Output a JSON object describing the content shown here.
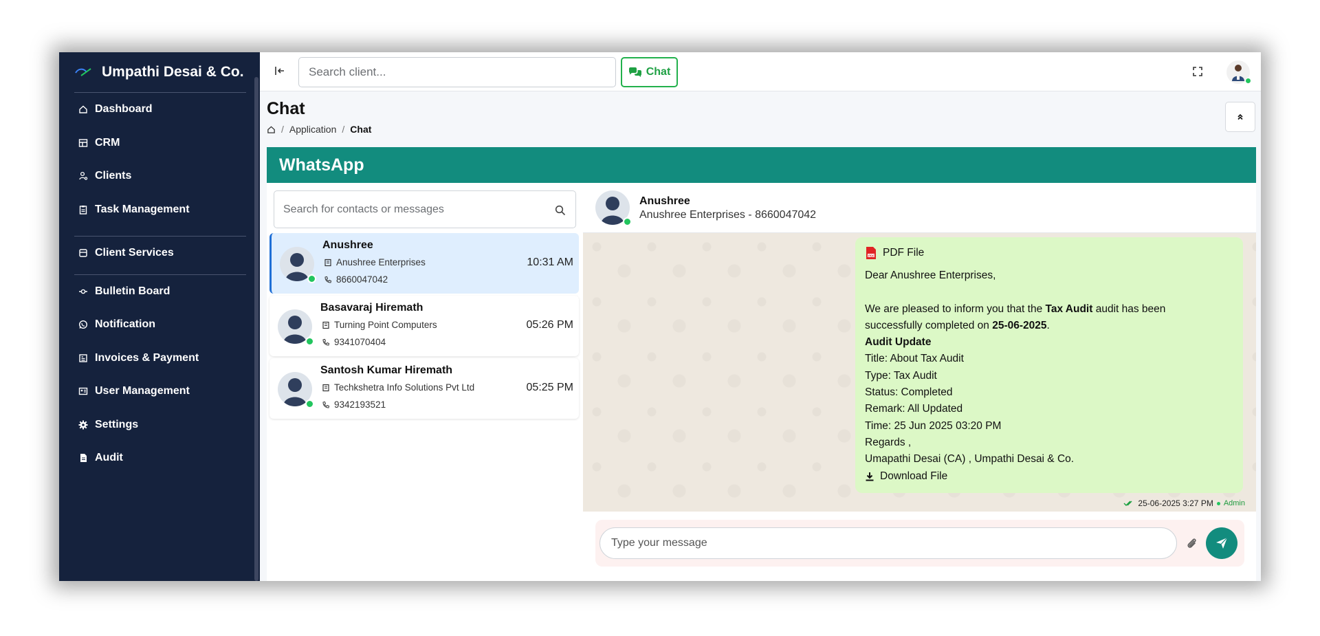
{
  "brand": {
    "name": "Umpathi Desai & Co."
  },
  "sidebar": {
    "items": [
      {
        "label": "Dashboard",
        "icon": "home-icon"
      },
      {
        "label": "CRM",
        "icon": "table-icon"
      },
      {
        "label": "Clients",
        "icon": "users-icon"
      },
      {
        "label": "Task Management",
        "icon": "clipboard-icon"
      },
      {
        "label": "Client Services",
        "icon": "box-icon"
      },
      {
        "label": "Bulletin Board",
        "icon": "pin-icon"
      },
      {
        "label": "Notification",
        "icon": "whatsapp-icon"
      },
      {
        "label": "Invoices & Payment",
        "icon": "invoice-icon"
      },
      {
        "label": "User Management",
        "icon": "user-card-icon"
      },
      {
        "label": "Settings",
        "icon": "gear-icon"
      },
      {
        "label": "Audit",
        "icon": "file-icon"
      }
    ]
  },
  "topbar": {
    "search_placeholder": "Search client...",
    "chat_label": "Chat"
  },
  "page": {
    "title": "Chat",
    "breadcrumb": [
      "Application",
      "Chat"
    ]
  },
  "whatsapp": {
    "title": "WhatsApp",
    "search_placeholder": "Search for contacts or messages",
    "contacts": [
      {
        "name": "Anushree",
        "org": "Anushree Enterprises",
        "phone": "8660047042",
        "time": "10:31 AM",
        "active": true
      },
      {
        "name": "Basavaraj Hiremath",
        "org": "Turning Point Computers",
        "phone": "9341070404",
        "time": "05:26 PM",
        "active": false
      },
      {
        "name": "Santosh Kumar Hiremath",
        "org": "Techkshetra Info Solutions Pvt Ltd",
        "phone": "9342193521",
        "time": "05:25 PM",
        "active": false
      }
    ],
    "chat_header": {
      "name": "Anushree",
      "subtitle": "Anushree Enterprises - 8660047042"
    },
    "message": {
      "attachment_label": "PDF File",
      "greeting": "Dear Anushree Enterprises,",
      "intro_a": "We are pleased to inform you that the ",
      "intro_bold": "Tax Audit",
      "intro_b": " audit has been",
      "intro_c": "successfully completed on ",
      "intro_date": "25-06-2025",
      "intro_end": ".",
      "update_heading": "Audit Update",
      "title_line": "Title: About Tax Audit",
      "type_line": "Type: Tax Audit",
      "status_line": "Status: Completed",
      "remark_line": "Remark: All Updated",
      "time_line": "Time: 25 Jun 2025 03:20 PM",
      "regards": "Regards ,",
      "signature": "Umapathi Desai (CA) , Umpathi Desai & Co.",
      "download_label": "Download File",
      "timestamp": "25-06-2025 3:27 PM",
      "sender": "Admin"
    },
    "composer_placeholder": "Type your message"
  },
  "colors": {
    "sidebar_bg": "#15223d",
    "whatsapp_green": "#128c7e",
    "bubble_bg": "#dcf8c6",
    "accent_green": "#22b14c",
    "active_contact_bg": "#dfeefe"
  }
}
